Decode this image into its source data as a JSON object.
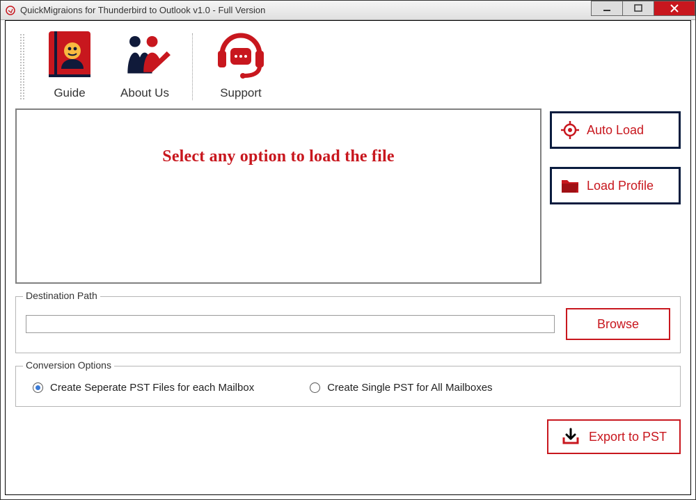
{
  "window": {
    "title": "QuickMigraions for Thunderbird to Outlook v1.0 - Full Version"
  },
  "toolbar": {
    "guide": "Guide",
    "about": "About Us",
    "support": "Support"
  },
  "main": {
    "prompt": "Select any option to load the file"
  },
  "buttons": {
    "auto_load": "Auto Load",
    "load_profile": "Load Profile",
    "browse": "Browse",
    "export": "Export to PST"
  },
  "groups": {
    "destination": "Destination Path",
    "conversion": "Conversion Options"
  },
  "inputs": {
    "destination_value": ""
  },
  "options": {
    "opt1": "Create Seperate PST Files for each Mailbox",
    "opt2": "Create Single PST for All Mailboxes",
    "selected": "opt1"
  },
  "colors": {
    "brand": "#c8171e",
    "dark_border": "#0a1c3e"
  }
}
